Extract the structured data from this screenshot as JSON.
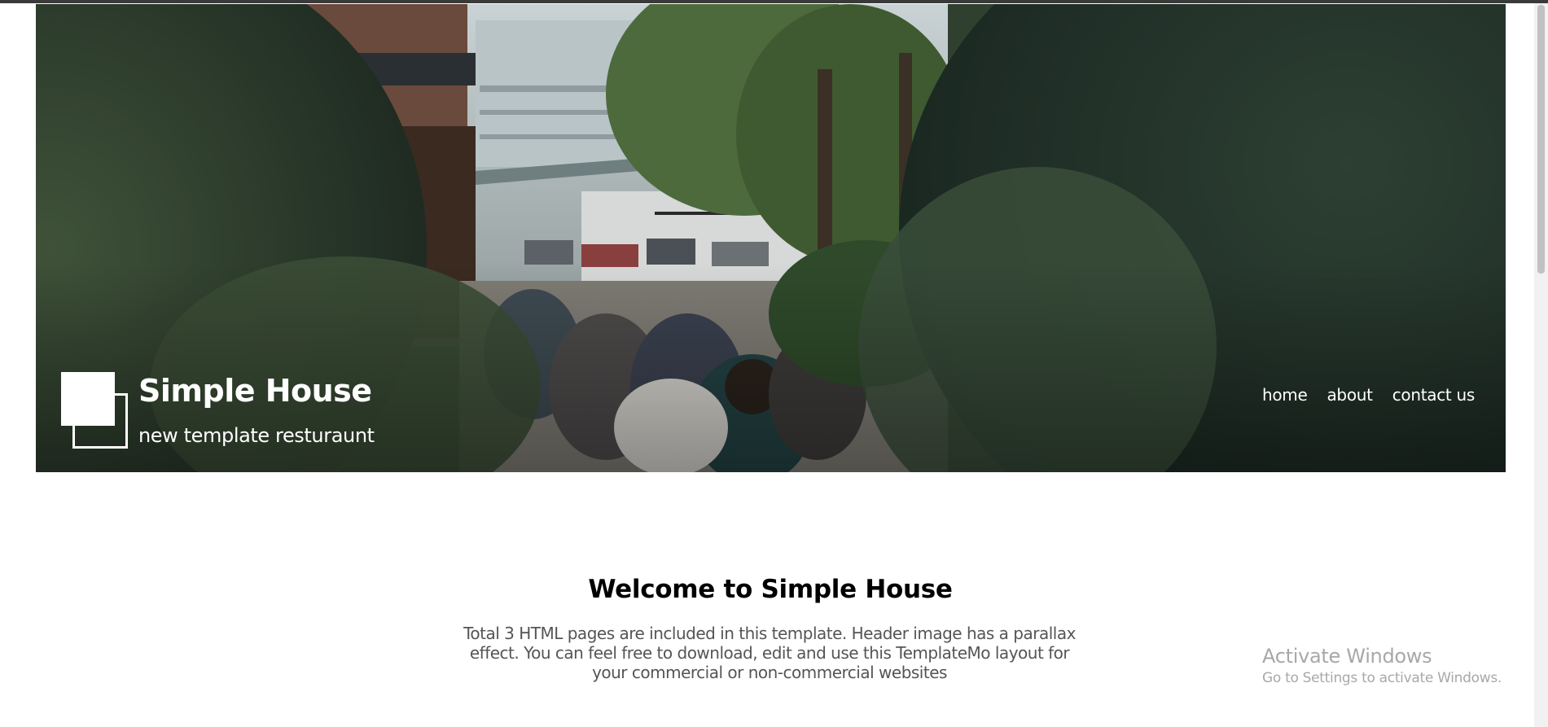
{
  "header": {
    "site_title": "Simple House",
    "site_subtitle": "new template resturaunt",
    "nav": [
      {
        "label": "home"
      },
      {
        "label": "about"
      },
      {
        "label": "contact us"
      }
    ],
    "hero_image": "restaurant-street-patio-photo"
  },
  "main": {
    "welcome_title": "Welcome to Simple House",
    "welcome_text": "Total 3 HTML pages are included in this template. Header image has a parallax effect. You can feel free to download, edit and use this TemplateMo layout for your commercial or non-commercial websites"
  },
  "os_overlay": {
    "activate_title": "Activate Windows",
    "activate_sub": "Go to Settings to activate Windows."
  },
  "colors": {
    "hero_foliage": "#2b3a2c",
    "text_body": "#555555",
    "watermark": "#a8a8a8"
  }
}
